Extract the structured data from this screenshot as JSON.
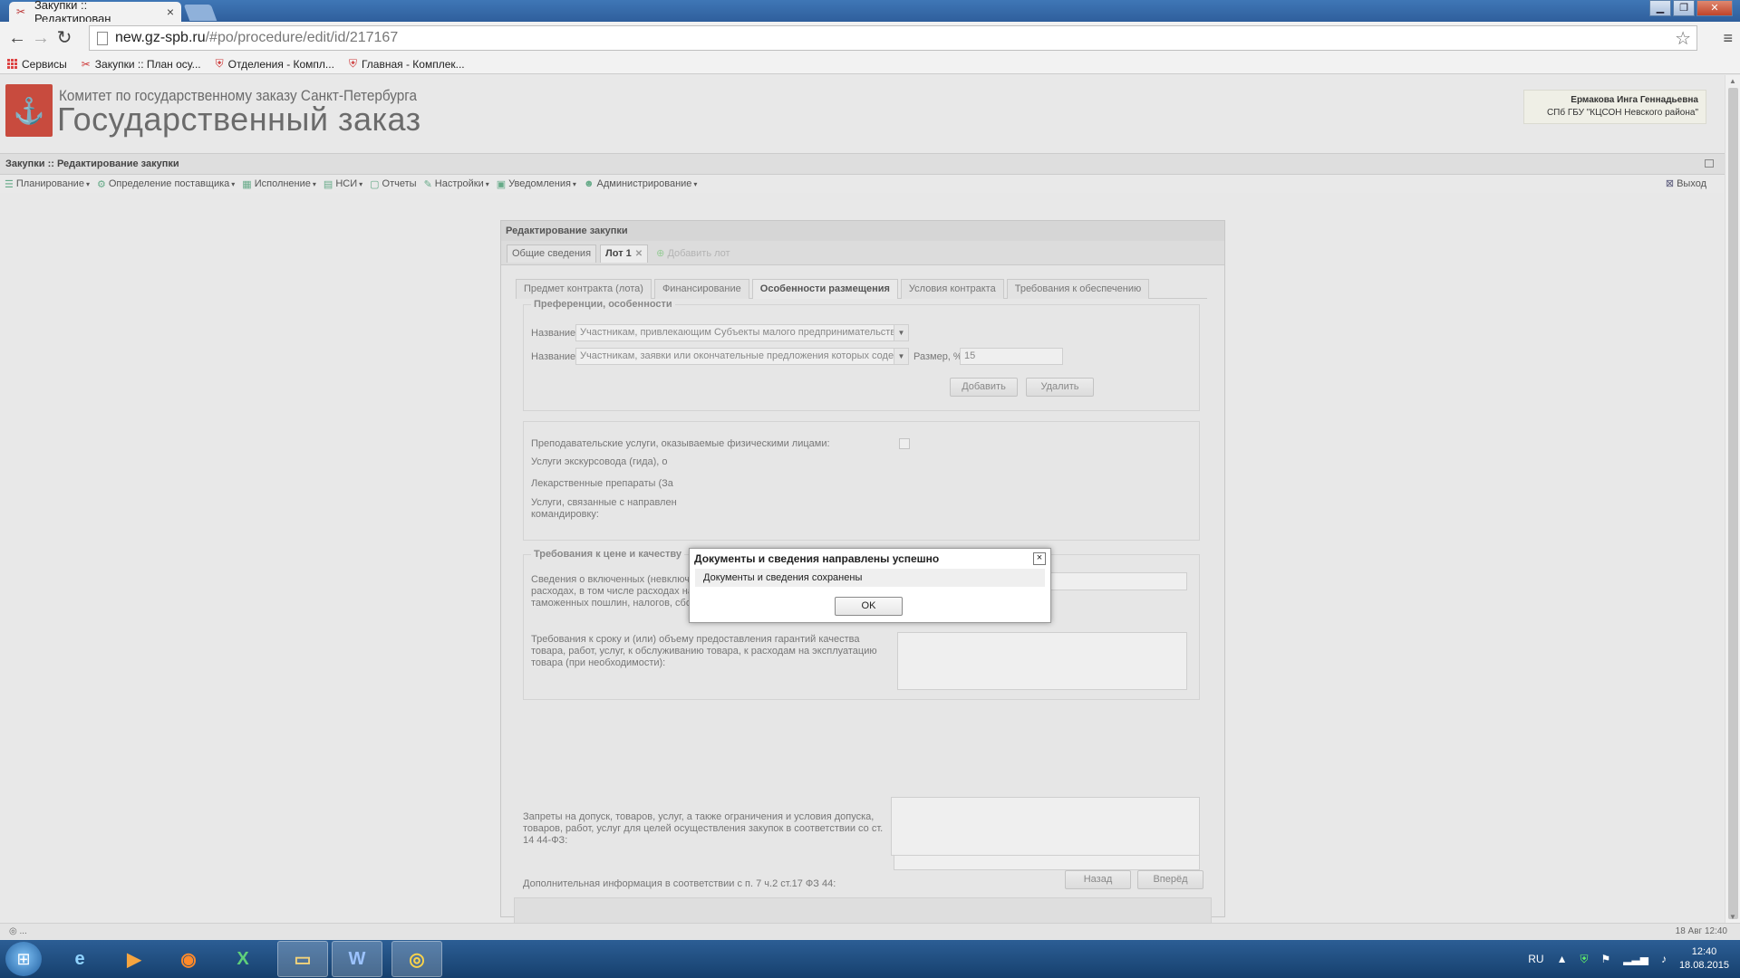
{
  "browser": {
    "tab_title": "Закупки :: Редактирован",
    "url_host": "new.gz-spb.ru",
    "url_path": "/#po/procedure/edit/id/217167",
    "bookmarks": [
      "Сервисы",
      "Закупки :: План осу...",
      "Отделения - Компл...",
      "Главная - Комплек..."
    ]
  },
  "header": {
    "org_line": "Комитет по государственному заказу Санкт-Петербурга",
    "org_big": "Государственный заказ",
    "user_name": "Ермакова Инга Геннадьевна",
    "user_org": "СПб ГБУ \"КЦСОН Невского района\""
  },
  "breadcrumb": "Закупки :: Редактирование закупки",
  "menu": {
    "items": [
      "Планирование",
      "Определение поставщика",
      "Исполнение",
      "НСИ",
      "Отчеты",
      "Настройки",
      "Уведомления",
      "Администрирование"
    ],
    "logout": "Выход"
  },
  "panel": {
    "title": "Редактирование закупки",
    "outer_tabs": [
      "Общие сведения",
      "Лот 1",
      "Добавить лот"
    ],
    "inner_tabs": [
      "Предмет контракта (лота)",
      "Финансирование",
      "Особенности размещения",
      "Условия контракта",
      "Требования к обеспечению"
    ],
    "prefs": {
      "legend": "Преференции, особенности",
      "name_label": "Название:",
      "name1_value": "Участникам, привлекающим Субъекты малого предпринимательства в качестве",
      "name2_value": "Участникам, заявки или окончательные предложения которых содержат пр",
      "size_label": "Размер, %:",
      "size_value": "15",
      "add_btn": "Добавить",
      "delete_btn": "Удалить"
    },
    "services": {
      "teaching": "Преподавательские услуги, оказываемые физическими лицами:",
      "guide": "Услуги экскурсовода (гида), о",
      "medicine": "Лекарственные препараты (За",
      "business_trip_1": "Услуги, связанные с направлен",
      "business_trip_2": "командировку:"
    },
    "price": {
      "legend": "Требования к цене и качеству",
      "info_included": "Сведения о включенных (невключенных) в цену товаров, работ, услуг расходах, в том числе расходах на перевозку, страхование, уплату таможенных пошлин, налогов, сборов и других обязательных платежей:",
      "warranty": "Требования к сроку и (или) объему предоставления гарантий качества товара, работ, услуг, к обслуживанию товара, к расходам на эксплуатацию товара (при необходимости):"
    },
    "bans": "Запреты на допуск, товаров, услуг, а также ограничения и условия допуска, товаров, работ, услуг для целей осуществления закупок в соответствии со ст. 14 44-ФЗ:",
    "additional": "Дополнительная информация в соответствии с п. 7 ч.2 ст.17 ФЗ 44:",
    "back_btn": "Назад",
    "forward_btn": "Вперёд"
  },
  "dialog": {
    "title": "Документы и сведения направлены успешно",
    "message": "Документы и сведения сохранены",
    "ok": "OK"
  },
  "statusbar": {
    "left": "◎ ...",
    "right": "18 Авг 12:40"
  },
  "taskbar": {
    "lang": "RU",
    "time": "12:40",
    "date": "18.08.2015"
  },
  "colors": {
    "title_bar": "#2f5f9c",
    "logo_red": "#c84b3e",
    "taskbar": "#16406d"
  }
}
